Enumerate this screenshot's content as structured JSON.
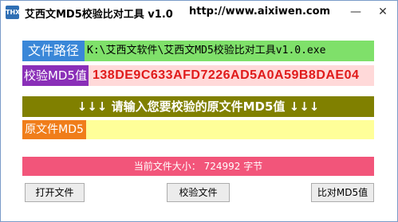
{
  "window": {
    "app_icon_text": "THX",
    "title": "艾西文MD5校验比对工具 v1.0",
    "url": "http://www.aixiwen.com",
    "minimize_glyph": "—",
    "close_glyph": "✕"
  },
  "path": {
    "label": "文件路径",
    "value": "K:\\艾西文软件\\艾西文MD5校验比对工具v1.0.exe"
  },
  "md5": {
    "label": "校验MD5值",
    "value": "138DE9C633AFD7226AD5A0A59B8DAE04"
  },
  "banner": {
    "text": "↓↓↓ 请输入您要校验的原文件MD5值 ↓↓↓"
  },
  "original_md5": {
    "label": "原文件MD5",
    "value": ""
  },
  "status": {
    "text": "当前文件大小：  724992 字节"
  },
  "buttons": {
    "open": "打开文件",
    "check": "校验文件",
    "compare": "比对MD5值"
  },
  "colors": {
    "path_label_bg": "#3a87d8",
    "path_field_bg": "#7fe06a",
    "md5_label_bg": "#8a2fb8",
    "md5_field_bg": "#ffd9d9",
    "md5_text": "#e01a1a",
    "banner_bg": "#808000",
    "orig_label_bg": "#f07d1a",
    "orig_field_bg": "#ffff99",
    "status_bg": "#f2557a"
  }
}
